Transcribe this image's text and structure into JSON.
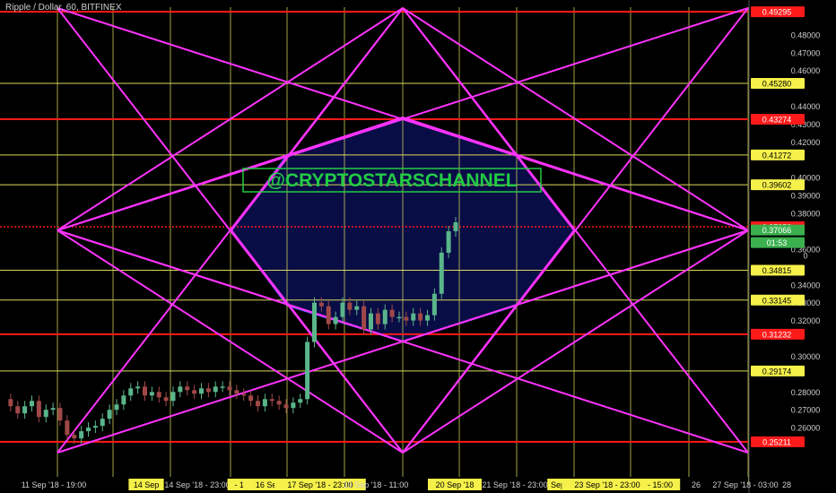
{
  "header": {
    "title": "Ripple / Dollar, 60, BITFINEX"
  },
  "watermark": "@CRYPTOSTARSCHANNEL",
  "colors": {
    "background": "#000000",
    "grid_yellow": "#d8d85a",
    "level_red": "#ff1a1a",
    "star_magenta": "#ff33ff",
    "hexagon_blue": "#4a5cff",
    "hexagon_fill": "#0a0f52",
    "candle_up": "#5ab58a",
    "candle_down": "#a04848",
    "watermark_green": "#22cc44",
    "price_label_bg": "#3bb04f"
  },
  "chart_data": {
    "type": "candlestick",
    "ylim": [
      0.246,
      0.4955
    ],
    "y_ticks": [
      "0.48000",
      "0.47000",
      "0.46000",
      "0.44000",
      "0.43000",
      "0.42000",
      "0.40000",
      "0.39000",
      "0.38000",
      "0.36000",
      "0.34000",
      "0.33000",
      "0.32000",
      "0.30000",
      "0.28000",
      "0.27000",
      "0.26000"
    ],
    "red_levels": [
      "0.49295",
      "0.43274",
      "0.37253",
      "0.31232",
      "0.25211"
    ],
    "yellow_levels": [
      "0.45280",
      "0.41272",
      "0.39602",
      "0.34815",
      "0.33145",
      "0.29174"
    ],
    "current_price": "0.37066",
    "countdown": "01:53",
    "extra_label": "0",
    "x_labels": [
      {
        "text": "11 Sep '18 - 19:00",
        "highlight": false
      },
      {
        "text": "14 Sep",
        "highlight": true
      },
      {
        "text": "14 Sep '18 - 23:00",
        "highlight": false
      },
      {
        "text": "- 1!",
        "highlight": true
      },
      {
        "text": "16 Sep '18 - 1!",
        "highlight": true
      },
      {
        "text": "17 Sep '18 - 23:00",
        "highlight": true
      },
      {
        "text": "19 Sep '18 - 11:00",
        "highlight": false
      },
      {
        "text": "20 Sep '18",
        "highlight": true
      },
      {
        "text": "21 Sep '18 - 23:00",
        "highlight": false
      },
      {
        "text": "Sep",
        "highlight": true
      },
      {
        "text": "23 Sep '18 - 23:00",
        "highlight": true
      },
      {
        "text": "- 15:00",
        "highlight": true
      },
      {
        "text": "26",
        "highlight": false
      },
      {
        "text": "27 Sep '18 - 03:00",
        "highlight": false
      },
      {
        "text": "28",
        "highlight": false
      }
    ],
    "price_path": [
      0.276,
      0.272,
      0.268,
      0.272,
      0.275,
      0.266,
      0.27,
      0.271,
      0.264,
      0.256,
      0.254,
      0.258,
      0.26,
      0.261,
      0.265,
      0.27,
      0.273,
      0.278,
      0.282,
      0.283,
      0.278,
      0.28,
      0.277,
      0.275,
      0.28,
      0.283,
      0.281,
      0.279,
      0.282,
      0.28,
      0.283,
      0.283,
      0.281,
      0.279,
      0.278,
      0.275,
      0.272,
      0.276,
      0.275,
      0.273,
      0.271,
      0.274,
      0.276,
      0.308,
      0.33,
      0.328,
      0.318,
      0.322,
      0.33,
      0.326,
      0.328,
      0.315,
      0.324,
      0.318,
      0.326,
      0.322,
      0.322,
      0.32,
      0.324,
      0.32,
      0.323,
      0.335,
      0.358,
      0.37,
      0.375
    ]
  }
}
